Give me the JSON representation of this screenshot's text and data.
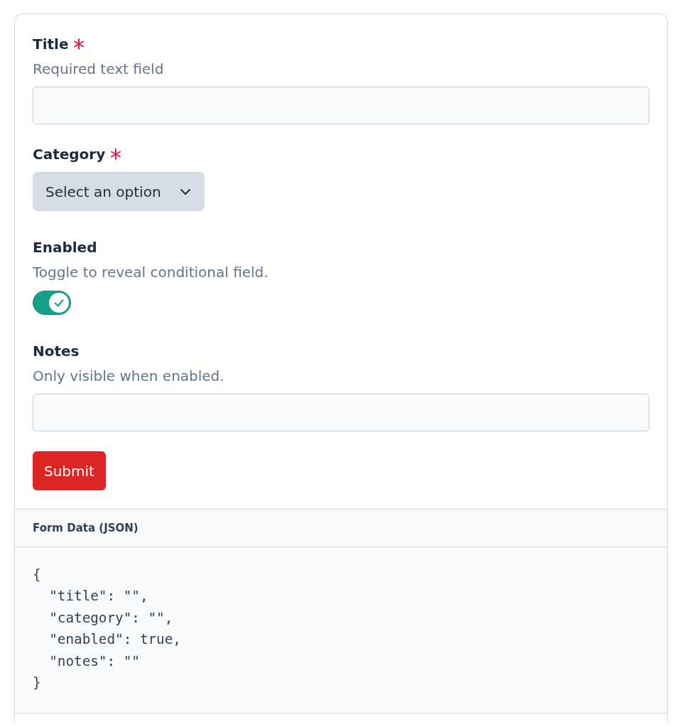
{
  "form": {
    "fields": [
      {
        "kind": "text",
        "label": "Title",
        "required": true,
        "description": "Required text field"
      },
      {
        "kind": "select",
        "label": "Category",
        "required": true,
        "placeholder": "Select an option"
      },
      {
        "kind": "toggle",
        "label": "Enabled",
        "required": false,
        "description": "Toggle to reveal conditional field.",
        "on": true
      },
      {
        "kind": "text",
        "label": "Notes",
        "required": false,
        "description": "Only visible when enabled."
      }
    ],
    "submit": {
      "label": "Submit"
    }
  },
  "preview": {
    "title": "Form Data (JSON)",
    "code": "{\n  \"title\": \"\",\n  \"category\": \"\",\n  \"enabled\": true,\n  \"notes\": \"\"\n}"
  }
}
